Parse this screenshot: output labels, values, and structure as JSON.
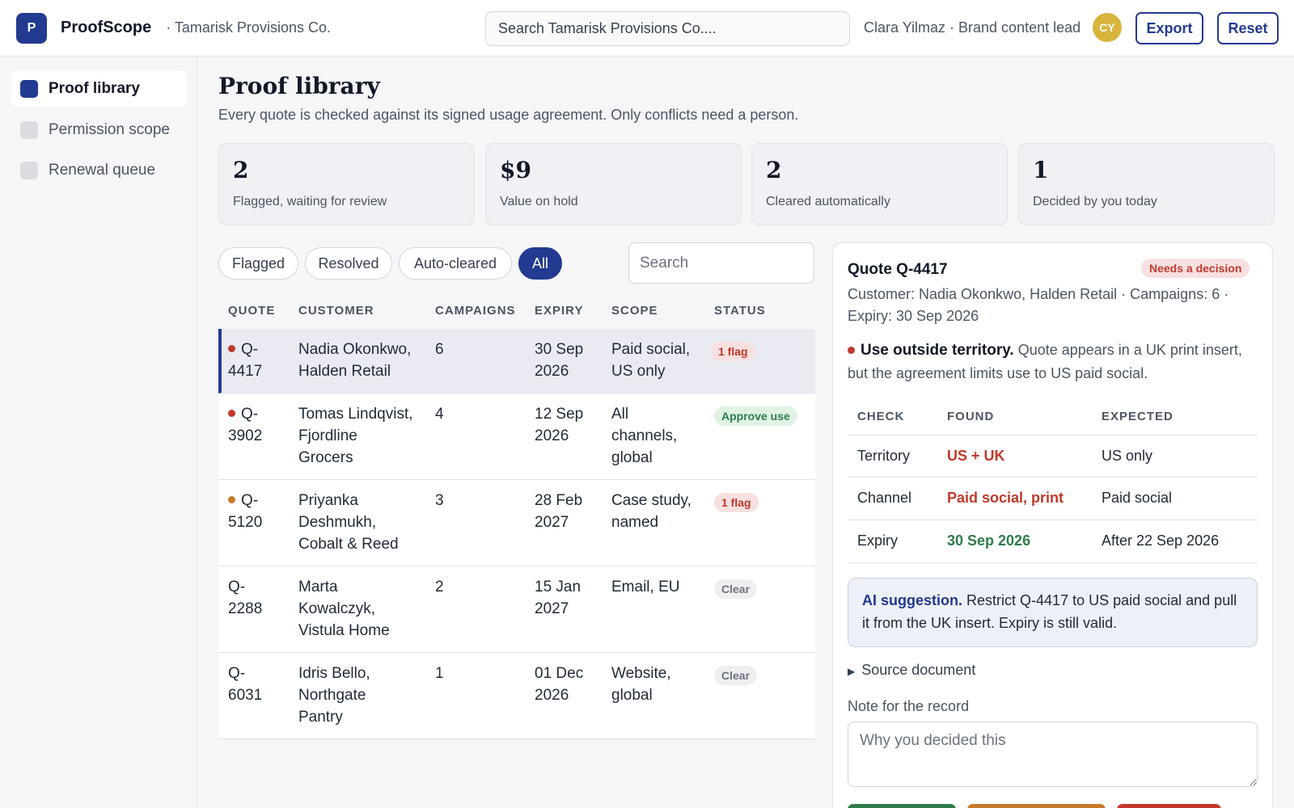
{
  "app": {
    "logo_letter": "P",
    "name": "ProofScope",
    "org": "· Tamarisk Provisions Co."
  },
  "search": {
    "placeholder": "Search Tamarisk Provisions Co...."
  },
  "user": {
    "label": "Clara Yilmaz · Brand content lead",
    "initials": "CY"
  },
  "toolbar": {
    "export_label": "Export",
    "reset_label": "Reset"
  },
  "sidebar": {
    "items": [
      {
        "label": "Proof library",
        "active": true
      },
      {
        "label": "Permission scope",
        "active": false
      },
      {
        "label": "Renewal queue",
        "active": false
      }
    ]
  },
  "page": {
    "title": "Proof library",
    "subtitle": "Every quote is checked against its signed usage agreement. Only conflicts need a person."
  },
  "stats": [
    {
      "value": "2",
      "label": "Flagged, waiting for review"
    },
    {
      "value": "$9",
      "label": "Value on hold"
    },
    {
      "value": "2",
      "label": "Cleared automatically"
    },
    {
      "value": "1",
      "label": "Decided by you today"
    }
  ],
  "filters": [
    {
      "label": "Flagged",
      "active": false
    },
    {
      "label": "Resolved",
      "active": false
    },
    {
      "label": "Auto-cleared",
      "active": false
    },
    {
      "label": "All",
      "active": true
    }
  ],
  "list_search": {
    "placeholder": "Search"
  },
  "table": {
    "headers": [
      "QUOTE",
      "CUSTOMER",
      "CAMPAIGNS",
      "EXPIRY",
      "SCOPE",
      "STATUS"
    ],
    "rows": [
      {
        "quote_a": "Q-",
        "quote_b": "4417",
        "dot": "#c0392b",
        "customer_a": "Nadia Okonkwo,",
        "customer_b": "Halden Retail",
        "customer_c": "",
        "campaigns": "6",
        "expiry_a": "30 Sep",
        "expiry_b": "2026",
        "scope_a": "Paid social,",
        "scope_b": "US only",
        "scope_c": "",
        "status": "1 flag",
        "status_kind": "flag"
      },
      {
        "quote_a": "Q-",
        "quote_b": "3902",
        "dot": "#c0392b",
        "customer_a": "Tomas Lindqvist,",
        "customer_b": "Fjordline",
        "customer_c": "Grocers",
        "campaigns": "4",
        "expiry_a": "12 Sep",
        "expiry_b": "2026",
        "scope_a": "All",
        "scope_b": "channels,",
        "scope_c": "global",
        "status": "Approve use",
        "status_kind": "approve"
      },
      {
        "quote_a": "Q-",
        "quote_b": "5120",
        "dot": "#c87a2a",
        "customer_a": "Priyanka",
        "customer_b": "Deshmukh,",
        "customer_c": "Cobalt & Reed",
        "campaigns": "3",
        "expiry_a": "28 Feb",
        "expiry_b": "2027",
        "scope_a": "Case study,",
        "scope_b": "named",
        "scope_c": "",
        "status": "1 flag",
        "status_kind": "flag"
      },
      {
        "quote_a": "Q-",
        "quote_b": "2288",
        "dot": "",
        "customer_a": "Marta",
        "customer_b": "Kowalczyk,",
        "customer_c": "Vistula Home",
        "campaigns": "2",
        "expiry_a": "15 Jan",
        "expiry_b": "2027",
        "scope_a": "Email, EU",
        "scope_b": "",
        "scope_c": "",
        "status": "Clear",
        "status_kind": "clear"
      },
      {
        "quote_a": "Q-",
        "quote_b": "6031",
        "dot": "",
        "customer_a": "Idris Bello,",
        "customer_b": "Northgate",
        "customer_c": "Pantry",
        "campaigns": "1",
        "expiry_a": "01 Dec",
        "expiry_b": "2026",
        "scope_a": "Website,",
        "scope_b": "global",
        "scope_c": "",
        "status": "Clear",
        "status_kind": "clear"
      }
    ]
  },
  "detail": {
    "title": "Quote Q-4417",
    "badge": "Needs a decision",
    "meta": "Customer: Nadia Okonkwo, Halden Retail · Campaigns: 6 · Expiry: 30 Sep 2026",
    "issue_title": "Use outside territory.",
    "issue_text": "Quote appears in a UK print insert, but the agreement limits use to US paid social.",
    "check_headers": [
      "CHECK",
      "FOUND",
      "EXPECTED"
    ],
    "checks": [
      {
        "check": "Territory",
        "found": "US + UK",
        "found_kind": "bad",
        "expected": "US only"
      },
      {
        "check": "Channel",
        "found": "Paid social, print",
        "found_kind": "bad",
        "expected": "Paid social"
      },
      {
        "check": "Expiry",
        "found": "30 Sep 2026",
        "found_kind": "good",
        "expected": "After 22 Sep 2026"
      }
    ],
    "ai_label": "AI suggestion.",
    "ai_text": "Restrict Q-4417 to US paid social and pull it from the UK insert. Expiry is still valid.",
    "source_label": "Source document",
    "note_label": "Note for the record",
    "note_placeholder": "Why you decided this"
  },
  "colors": {
    "accent": "#233a91",
    "flag": "#c0392b",
    "warn": "#c87a2a",
    "ok": "#2e7d4a",
    "avatar": "#d8b43c"
  }
}
